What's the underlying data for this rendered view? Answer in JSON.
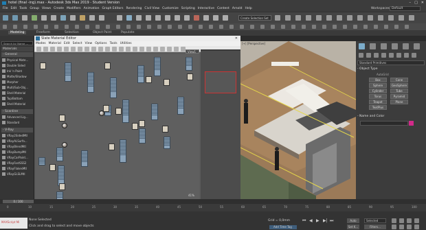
{
  "title": "hotel (final -ing).max - Autodesk 3ds Max 2019 - Student Version",
  "menus": [
    "File",
    "Edit",
    "Tools",
    "Group",
    "Views",
    "Create",
    "Modifiers",
    "Animation",
    "Graph Editors",
    "Rendering",
    "Civil View",
    "Customize",
    "Scripting",
    "Interactive",
    "Content",
    "Arnold",
    "Help"
  ],
  "workspaces_label": "Workspaces:",
  "workspace_value": "Default",
  "selection_set": "Create Selection Set",
  "ribbon_tabs": [
    "Modeling",
    "Freeform",
    "Selection",
    "Object Paint",
    "Populate"
  ],
  "left_panel": {
    "search_placeholder": "Search by Name ...",
    "materials_head": "Materials",
    "general_head": "- General",
    "general_items": [
      "Physical Mate...",
      "Double Sided",
      "Ink 'n Paint",
      "Matte/Shadow",
      "Morpher",
      "Multi/Sub-Obj...",
      "Shell Material",
      "Top/Bottom",
      "Shell Material"
    ],
    "scanline_head": "- Scanline",
    "scanline_items": [
      "Advanced Lig...",
      "Standard"
    ],
    "vray_head": "- V-Ray",
    "vray_items": [
      "VRay2SidedMtl",
      "VRayALSurfa...",
      "VRayBlendMtl",
      "VRayBumpMtl",
      "VRayCarPaint...",
      "VRayFastSSS2",
      "VRayFlakesMtl",
      "VRayGLSLMtl"
    ]
  },
  "sme": {
    "title": "Slate Material Editor",
    "menu": [
      "Modes",
      "Material",
      "Edit",
      "Select",
      "View",
      "Options",
      "Tools",
      "Utilities"
    ],
    "view_tab": "View1",
    "zoom": "41%"
  },
  "right_panel": {
    "dropdown": "Standard Primitives",
    "object_type_head": "- Object Type",
    "autogrid": "AutoGrid",
    "buttons": [
      "Box",
      "Cone",
      "Sphere",
      "GeoSphere",
      "Cylinder",
      "Tube",
      "Torus",
      "Pyramid",
      "Teapot",
      "Plane",
      "TextPlus"
    ],
    "name_color_head": "- Name and Color",
    "accent": "#d22a8a"
  },
  "timeline": {
    "frame": "0 / 100",
    "ticks": [
      "0",
      "10",
      "15",
      "20",
      "25",
      "30",
      "35",
      "40",
      "45",
      "50",
      "55",
      "60",
      "65",
      "70",
      "75",
      "80",
      "85",
      "90",
      "95",
      "100"
    ]
  },
  "status": {
    "none_selected": "None Selected",
    "hint": "Click and drag to select and move objects",
    "grid": "Grid = 0,0mm",
    "add_time_tag": "Add Time Tag",
    "auto": "Auto",
    "set_key": "Set K...",
    "selected": "Selected",
    "filters": "Filters...",
    "script_label": "MAXScript Mi"
  }
}
